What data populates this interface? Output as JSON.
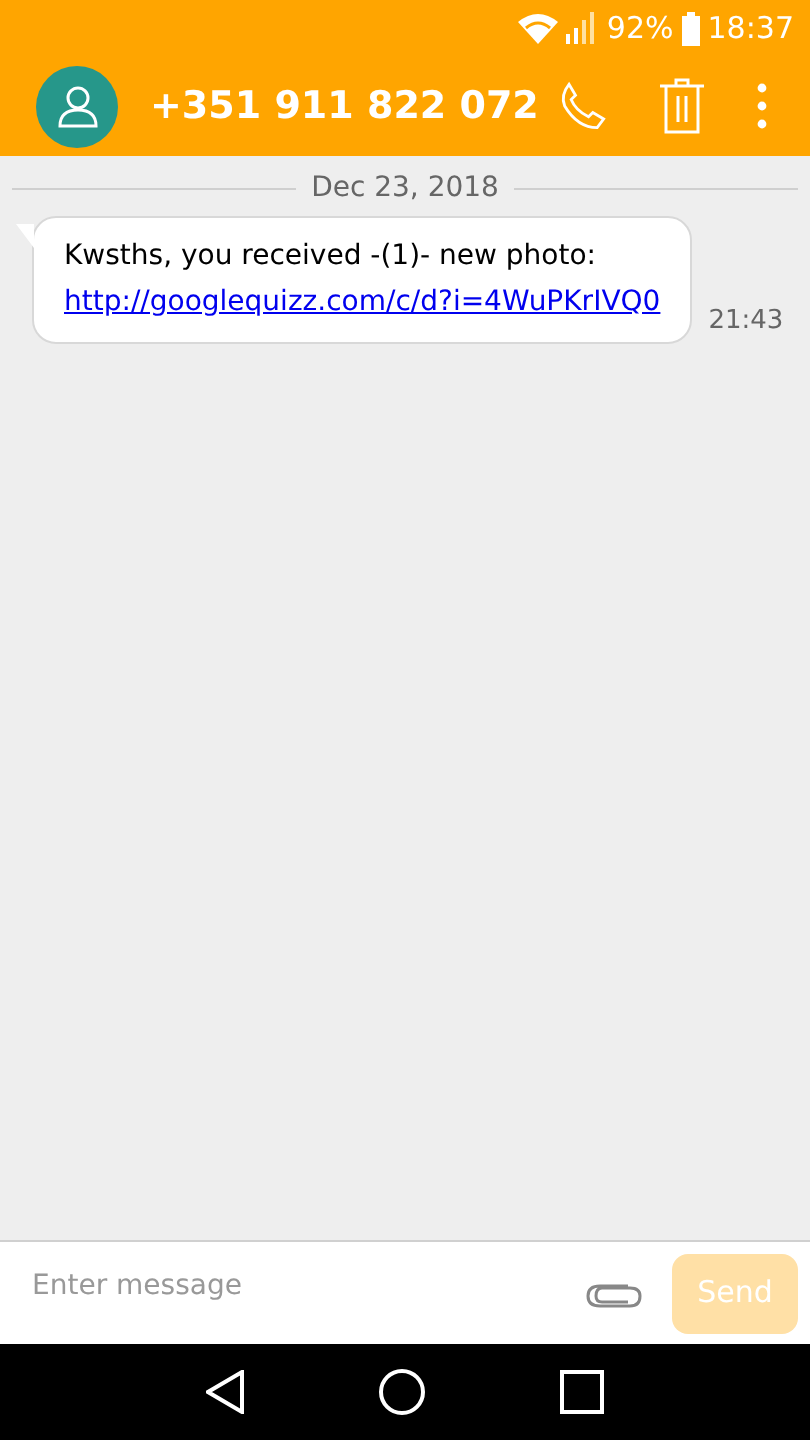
{
  "status_bar": {
    "battery": "92%",
    "time": "18:37"
  },
  "app_bar": {
    "title": "+351 911 822 072"
  },
  "conversation": {
    "date": "Dec 23, 2018",
    "messages": [
      {
        "text": "Kwsths, you received -(1)- new photo:",
        "link": "http://googlequizz.com/c/d?i=4WuPKrIVQ0",
        "time": "21:43"
      }
    ]
  },
  "composer": {
    "placeholder": "Enter message",
    "send": {
      "label": "Send",
      "disabled": true
    }
  }
}
